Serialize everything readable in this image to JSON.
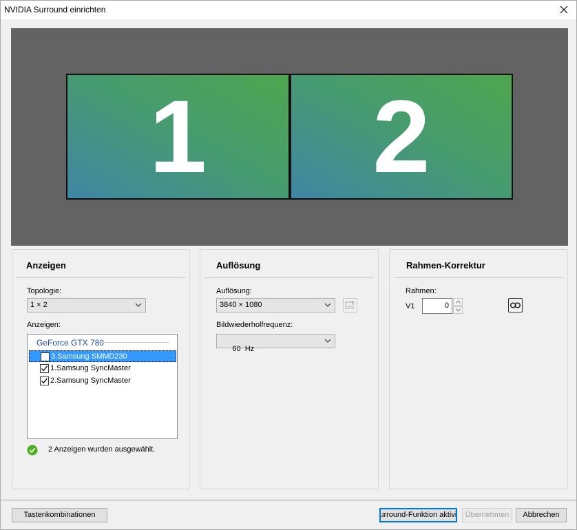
{
  "window": {
    "title": "NVIDIA Surround einrichten"
  },
  "preview": {
    "monitors": [
      {
        "number": "1"
      },
      {
        "number": "2"
      }
    ]
  },
  "anzeigen": {
    "title": "Anzeigen",
    "topology_label": "Topologie:",
    "topology_value": "1 × 2",
    "displays_label": "Anzeigen:",
    "gpu": "GeForce GTX 780",
    "items": [
      {
        "label": "3.Samsung SMMD230",
        "checked": false,
        "selected": true
      },
      {
        "label": "1.Samsung SyncMaster",
        "checked": true,
        "selected": false
      },
      {
        "label": "2.Samsung SyncMaster",
        "checked": true,
        "selected": false
      }
    ],
    "status": "2 Anzeigen wurden ausgewählt."
  },
  "aufloesung": {
    "title": "Auflösung",
    "resolution_label": "Auflösung:",
    "resolution_value": "3840 × 1080",
    "refresh_label": "Bildwiederholfrequenz:",
    "refresh_value": "60  Hz"
  },
  "rahmen": {
    "title": "Rahmen-Korrektur",
    "bezel_label": "Rahmen:",
    "v1_label": "V1",
    "v1_value": "0"
  },
  "footer": {
    "shortcuts": "Tastenkombinationen",
    "activate": "Surround-Funktion aktivieren",
    "apply": "Übernehmen",
    "cancel": "Abbrechen"
  },
  "colors": {
    "accent": "#0078d7",
    "selection": "#3399ff",
    "status_ok": "#4caf1f",
    "gpu_header": "#1e4e9c"
  }
}
